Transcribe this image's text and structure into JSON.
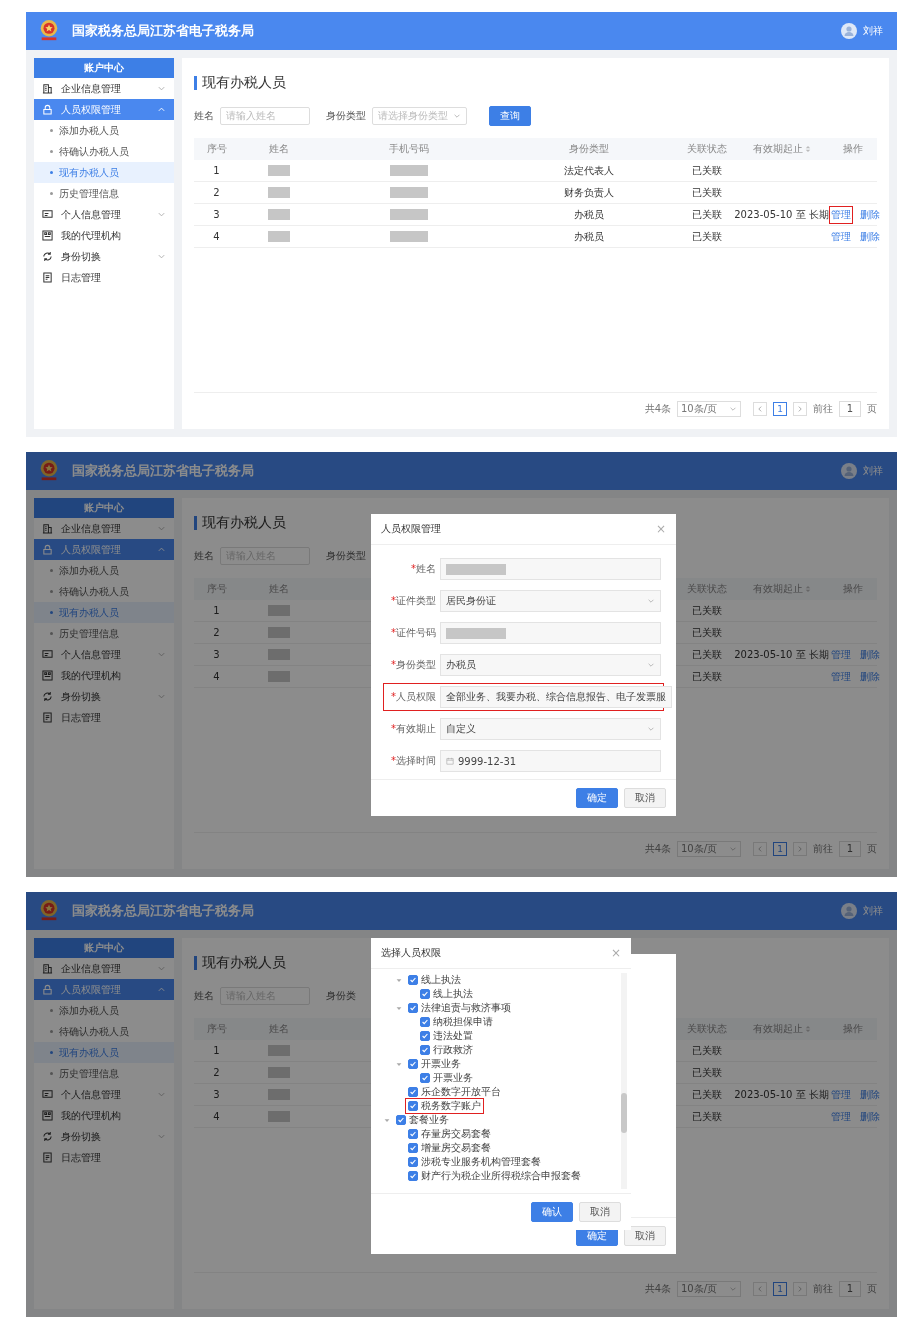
{
  "screens": [
    {
      "modal": false,
      "header": {
        "title": "国家税务总局江苏省电子税务局",
        "user": "刘祥"
      },
      "sidebar": {
        "title": "账户中心",
        "items": [
          {
            "label": "企业信息管理",
            "selected": false,
            "expanded": false
          },
          {
            "label": "人员权限管理",
            "selected": true,
            "expanded": true,
            "children": [
              {
                "label": "添加办税人员",
                "selected": false
              },
              {
                "label": "待确认办税人员",
                "selected": false
              },
              {
                "label": "现有办税人员",
                "selected": true
              },
              {
                "label": "历史管理信息",
                "selected": false
              }
            ]
          },
          {
            "label": "个人信息管理",
            "selected": false,
            "expanded": false
          },
          {
            "label": "我的代理机构",
            "selected": false
          },
          {
            "label": "身份切换",
            "selected": false,
            "expanded": false
          },
          {
            "label": "日志管理",
            "selected": false
          }
        ]
      },
      "content": {
        "title": "现有办税人员",
        "filters": [
          {
            "label": "姓名",
            "placeholder": "请输入姓名",
            "kind": "input"
          },
          {
            "label": "身份类型",
            "placeholder": "请选择身份类型",
            "kind": "select"
          }
        ],
        "search_button": "查询",
        "table": {
          "columns": [
            {
              "label": "序号",
              "sortable": false
            },
            {
              "label": "姓名",
              "sortable": false
            },
            {
              "label": "手机号码",
              "sortable": false
            },
            {
              "label": "身份类型",
              "sortable": false
            },
            {
              "label": "关联状态",
              "sortable": false
            },
            {
              "label": "有效期起止",
              "sortable": true
            },
            {
              "label": "操作",
              "sortable": false
            }
          ],
          "rows": [
            {
              "cells": [
                "1",
                {
                  "kind": "redacted"
                },
                {
                  "kind": "redacted"
                },
                "法定代表人",
                "已关联",
                null
              ],
              "actions": []
            },
            {
              "cells": [
                "2",
                {
                  "kind": "redacted"
                },
                {
                  "kind": "redacted"
                },
                "财务负责人",
                "已关联",
                null
              ],
              "actions": []
            },
            {
              "cells": [
                "3",
                {
                  "kind": "redacted"
                },
                {
                  "kind": "redacted"
                },
                "办税员",
                "已关联",
                "2023-05-10 至 长期"
              ],
              "actions": [
                {
                  "label": "管理",
                  "highlighted": true
                },
                {
                  "label": "删除",
                  "highlighted": false
                }
              ]
            },
            {
              "cells": [
                "4",
                {
                  "kind": "redacted"
                },
                {
                  "kind": "redacted"
                },
                "办税员",
                "已关联",
                null
              ],
              "actions": [
                {
                  "label": "管理",
                  "highlighted": false
                },
                {
                  "label": "删除",
                  "highlighted": false
                }
              ]
            }
          ]
        },
        "pagination": {
          "total": "共4条",
          "page_size": "10条/页",
          "pages": [
            {
              "label": "1",
              "selected": true
            }
          ],
          "goto_label": "前往",
          "goto_value": "1",
          "goto_suffix": "页"
        }
      }
    },
    {
      "modal": true,
      "header": {
        "title": "国家税务总局江苏省电子税务局",
        "user": "刘祥"
      },
      "sidebar": {
        "title": "账户中心",
        "items": [
          {
            "label": "企业信息管理",
            "selected": false,
            "expanded": false
          },
          {
            "label": "人员权限管理",
            "selected": true,
            "expanded": true,
            "children": [
              {
                "label": "添加办税人员",
                "selected": false
              },
              {
                "label": "待确认办税人员",
                "selected": false
              },
              {
                "label": "现有办税人员",
                "selected": true
              },
              {
                "label": "历史管理信息",
                "selected": false
              }
            ]
          },
          {
            "label": "个人信息管理",
            "selected": false,
            "expanded": false
          },
          {
            "label": "我的代理机构",
            "selected": false
          },
          {
            "label": "身份切换",
            "selected": false,
            "expanded": false
          },
          {
            "label": "日志管理",
            "selected": false
          }
        ]
      },
      "content": {
        "title": "现有办税人员",
        "filters": [
          {
            "label": "姓名",
            "placeholder": "请输入姓名",
            "kind": "input"
          },
          {
            "label": "身份类型"
          }
        ],
        "table": {
          "columns": [
            {
              "label": "序号",
              "sortable": false
            },
            {
              "label": "姓名",
              "sortable": false
            },
            null,
            null,
            {
              "label": "关联状态",
              "sortable": false
            },
            {
              "label": "有效期起止",
              "sortable": true
            },
            {
              "label": "操作",
              "sortable": false
            }
          ],
          "rows": [
            {
              "cells": [
                "1",
                {
                  "kind": "redacted"
                },
                null,
                null,
                "已关联",
                null
              ],
              "actions": []
            },
            {
              "cells": [
                "2",
                {
                  "kind": "redacted"
                },
                null,
                null,
                "已关联",
                null
              ],
              "actions": []
            },
            {
              "cells": [
                "3",
                {
                  "kind": "redacted"
                },
                null,
                null,
                "已关联",
                "2023-05-10 至 长期"
              ],
              "actions": [
                {
                  "label": "管理",
                  "highlighted": false
                },
                {
                  "label": "删除",
                  "highlighted": false
                }
              ]
            },
            {
              "cells": [
                "4",
                {
                  "kind": "redacted"
                },
                null,
                null,
                "已关联",
                null
              ],
              "actions": [
                {
                  "label": "管理",
                  "highlighted": false
                },
                {
                  "label": "删除",
                  "highlighted": false
                }
              ]
            }
          ]
        },
        "pagination": {
          "total": "共4条",
          "page_size": "10条/页",
          "pages": [
            {
              "label": "1",
              "selected": true
            }
          ],
          "goto_label": "前往",
          "goto_value": "1",
          "goto_suffix": "页"
        }
      },
      "dialog": {
        "title": "人员权限管理",
        "close": "×",
        "fields": [
          {
            "mark": "*",
            "label": "姓名",
            "kind": "redacted",
            "highlighted": false
          },
          {
            "mark": "*",
            "label": "证件类型",
            "kind": "select",
            "value": "居民身份证",
            "highlighted": false
          },
          {
            "mark": "*",
            "label": "证件号码",
            "kind": "redacted",
            "highlighted": false
          },
          {
            "mark": "*",
            "label": "身份类型",
            "kind": "select",
            "value": "办税员",
            "highlighted": false
          },
          {
            "mark": "*",
            "label": "人员权限",
            "kind": "text",
            "value": "全部业务、我要办税、综合信息报告、电子发票服",
            "highlighted": true
          },
          {
            "mark": "*",
            "label": "有效期止",
            "kind": "select",
            "value": "自定义",
            "highlighted": false
          },
          {
            "mark": "*",
            "label": "选择时间",
            "kind": "date",
            "value": "9999-12-31",
            "highlighted": false
          }
        ],
        "buttons": [
          {
            "label": "确定",
            "kind": "primary"
          },
          {
            "label": "取消",
            "kind": "default"
          }
        ]
      }
    },
    {
      "modal": true,
      "header": {
        "title": "国家税务总局江苏省电子税务局",
        "user": "刘祥"
      },
      "sidebar": {
        "title": "账户中心",
        "items": [
          {
            "label": "企业信息管理",
            "selected": false,
            "expanded": false
          },
          {
            "label": "人员权限管理",
            "selected": true,
            "expanded": true,
            "children": [
              {
                "label": "添加办税人员",
                "selected": false
              },
              {
                "label": "待确认办税人员",
                "selected": false
              },
              {
                "label": "现有办税人员",
                "selected": true
              },
              {
                "label": "历史管理信息",
                "selected": false
              }
            ]
          },
          {
            "label": "个人信息管理",
            "selected": false,
            "expanded": false
          },
          {
            "label": "我的代理机构",
            "selected": false
          },
          {
            "label": "身份切换",
            "selected": false,
            "expanded": false
          },
          {
            "label": "日志管理",
            "selected": false
          }
        ]
      },
      "content": {
        "title": "现有办税人员",
        "filters": [
          {
            "label": "姓名",
            "placeholder": "请输入姓名",
            "kind": "input"
          },
          {
            "label": "身份类"
          }
        ],
        "table": {
          "columns": [
            {
              "label": "序号",
              "sortable": false
            },
            {
              "label": "姓名",
              "sortable": false
            },
            null,
            null,
            {
              "label": "关联状态",
              "sortable": false
            },
            {
              "label": "有效期起止",
              "sortable": true
            },
            {
              "label": "操作",
              "sortable": false
            }
          ],
          "rows": [
            {
              "cells": [
                "1",
                {
                  "kind": "redacted"
                },
                null,
                null,
                "已关联",
                null
              ],
              "actions": []
            },
            {
              "cells": [
                "2",
                {
                  "kind": "redacted"
                },
                null,
                null,
                "已关联",
                null
              ],
              "actions": []
            },
            {
              "cells": [
                "3",
                {
                  "kind": "redacted"
                },
                null,
                null,
                "已关联",
                "2023-05-10 至 长期"
              ],
              "actions": [
                {
                  "label": "管理",
                  "highlighted": false
                },
                {
                  "label": "删除",
                  "highlighted": false
                }
              ]
            },
            {
              "cells": [
                "4",
                {
                  "kind": "redacted"
                },
                null,
                null,
                "已关联",
                null
              ],
              "actions": [
                {
                  "label": "管理",
                  "highlighted": false
                },
                {
                  "label": "删除",
                  "highlighted": false
                }
              ]
            }
          ]
        },
        "pagination": {
          "total": "共4条",
          "page_size": "10条/页",
          "pages": [
            {
              "label": "1",
              "selected": true
            }
          ],
          "goto_label": "前往",
          "goto_value": "1",
          "goto_suffix": "页"
        }
      },
      "dialog": {
        "buttons": [
          {
            "label": "确定",
            "kind": "primary"
          },
          {
            "label": "取消",
            "kind": "default"
          }
        ]
      },
      "tree_dialog": {
        "title": "选择人员权限",
        "close": "×",
        "tree": [
          {
            "children": [
              {
                "label": "线上执法",
                "checked": true,
                "expanded": true,
                "highlighted": false,
                "children": [
                  {
                    "label": "线上执法",
                    "checked": true,
                    "highlighted": false
                  }
                ]
              },
              {
                "label": "法律追责与救济事项",
                "checked": true,
                "expanded": true,
                "highlighted": false,
                "children": [
                  {
                    "label": "纳税担保申请",
                    "checked": true,
                    "highlighted": false
                  },
                  {
                    "label": "违法处置",
                    "checked": true,
                    "highlighted": false
                  },
                  {
                    "label": "行政救济",
                    "checked": true,
                    "highlighted": false
                  }
                ]
              },
              {
                "label": "开票业务",
                "checked": true,
                "expanded": true,
                "highlighted": false,
                "children": [
                  {
                    "label": "开票业务",
                    "checked": true,
                    "highlighted": false
                  }
                ]
              },
              {
                "label": "乐企数字开放平台",
                "checked": true,
                "highlighted": false
              },
              {
                "label": "税务数字账户",
                "checked": true,
                "highlighted": true
              }
            ]
          },
          {
            "label": "套餐业务",
            "checked": true,
            "expanded": true,
            "highlighted": false,
            "children": [
              {
                "label": "存量房交易套餐",
                "checked": true,
                "highlighted": false
              },
              {
                "label": "增量房交易套餐",
                "checked": true,
                "highlighted": false
              },
              {
                "label": "涉税专业服务机构管理套餐",
                "checked": true,
                "highlighted": false
              },
              {
                "label": "财产行为税企业所得税综合申报套餐",
                "checked": true,
                "highlighted": false
              }
            ]
          }
        ],
        "buttons": [
          {
            "label": "确认",
            "kind": "primary"
          },
          {
            "label": "取消",
            "kind": "default"
          }
        ]
      }
    }
  ]
}
